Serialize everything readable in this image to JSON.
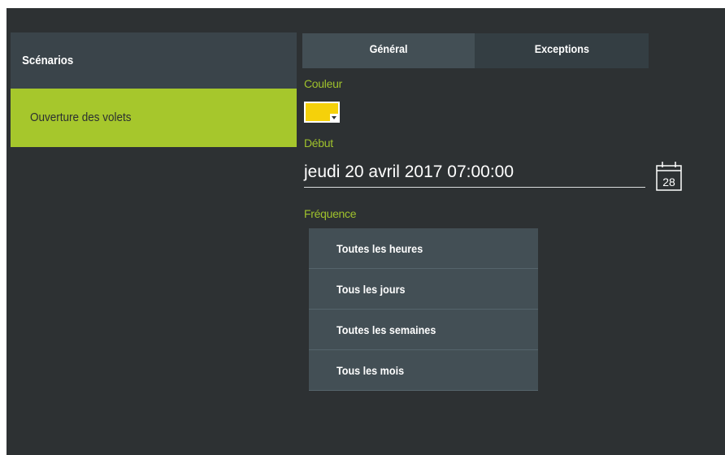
{
  "sidebar": {
    "header": "Scénarios",
    "items": [
      {
        "label": "Ouverture des volets"
      }
    ]
  },
  "tabs": [
    {
      "label": "Général",
      "active": true
    },
    {
      "label": "Exceptions",
      "active": false
    }
  ],
  "form": {
    "color_label": "Couleur",
    "color_value": "#f5d10a",
    "start_label": "Début",
    "start_value": "jeudi 20 avril 2017 07:00:00",
    "calendar_day": "28",
    "frequency_label": "Fréquence",
    "frequency_options": [
      "Toutes les heures",
      "Tous les jours",
      "Toutes les semaines",
      "Tous les mois"
    ]
  },
  "colors": {
    "accent": "#a6c72c",
    "label": "#9fc12c",
    "background": "#2d3133",
    "panel": "#434f55"
  }
}
